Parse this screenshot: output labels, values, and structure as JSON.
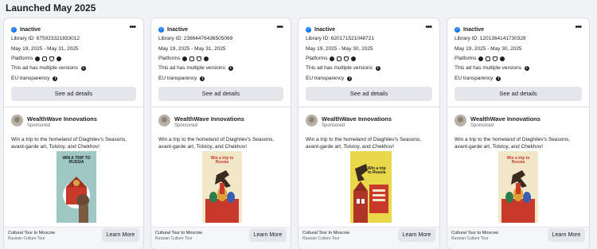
{
  "section_title": "Launched May 2025",
  "cards": [
    {
      "status": "Inactive",
      "library_id": "Library ID: 675923321833012",
      "dates": "May 19, 2025 - May 31, 2025",
      "platforms_label": "Platforms",
      "versions_text": "This ad has multiple versions",
      "eu_text": "EU transparency",
      "see_details": "See ad details",
      "advertiser": "WealthWave Innovations",
      "sponsored": "Sponsored",
      "body": "Win a trip to the homeland of Diaghilev's Seasons, avant-garde art, Tolstoy, and Chekhov!",
      "creative_text": "WIN A TRIP TO RUSSIA",
      "footer_title": "Cultural Tour to Moscow",
      "footer_sub": "Russian Culture Tour",
      "cta": "Learn More"
    },
    {
      "status": "Inactive",
      "library_id": "Library ID: 23864476436505069",
      "dates": "May 19, 2025 - May 31, 2025",
      "platforms_label": "Platforms",
      "versions_text": "This ad has multiple versions",
      "eu_text": "EU transparency",
      "see_details": "See ad details",
      "advertiser": "WealthWave Innovations",
      "sponsored": "Sponsored",
      "body": "Win a trip to the homeland of Diaghilev's Seasons, avant-garde art, Tolstoy, and Chekhov!",
      "creative_text": "Win a trip to Russia",
      "footer_title": "Cultural Tour to Moscow",
      "footer_sub": "Russian Culture Tour",
      "cta": "Learn More"
    },
    {
      "status": "Inactive",
      "library_id": "Library ID: 620171521048721",
      "dates": "May 19, 2025 - May 30, 2025",
      "platforms_label": "Platforms",
      "versions_text": "This ad has multiple versions",
      "eu_text": "EU transparency",
      "see_details": "See ad details",
      "advertiser": "WealthWave Innovations",
      "sponsored": "Sponsored",
      "body": "Win a trip to the homeland of Diaghilev's Seasons, avant-garde art, Tolstoy, and Chekhov!",
      "creative_text": "Win a trip to Russia",
      "footer_title": "Cultural Tour to Moscow",
      "footer_sub": "Russian Culture Tour",
      "cta": "Learn More"
    },
    {
      "status": "Inactive",
      "library_id": "Library ID: 1201364141730328",
      "dates": "May 19, 2025 - May 30, 2025",
      "platforms_label": "Platforms",
      "versions_text": "This ad has multiple versions",
      "eu_text": "EU transparency",
      "see_details": "See ad details",
      "advertiser": "WealthWave Innovations",
      "sponsored": "Sponsored",
      "body": "Win a trip to the homeland of Diaghilev's Seasons, avant-garde art, Tolstoy, and Chekhov!",
      "creative_text": "Win a trip to Russia",
      "footer_title": "Cultural Tour to Moscow",
      "footer_sub": "Russian Culture Tour",
      "cta": "Learn More"
    }
  ],
  "icons": {
    "status": "check-circle-icon",
    "more": "more-options-icon",
    "platforms": [
      "facebook-icon",
      "instagram-icon",
      "audience-network-icon",
      "messenger-icon"
    ],
    "info": "info-icon"
  },
  "colors": {
    "status_blue": "#1877f2",
    "button_gray": "#e4e6eb",
    "creative1_bg": "#9fc7c3",
    "creative2_bg": "#f2e7c9",
    "creative3_bg": "#e8d84a",
    "creative4_bg": "#f2e7c9",
    "creative_red": "#c8392b"
  }
}
